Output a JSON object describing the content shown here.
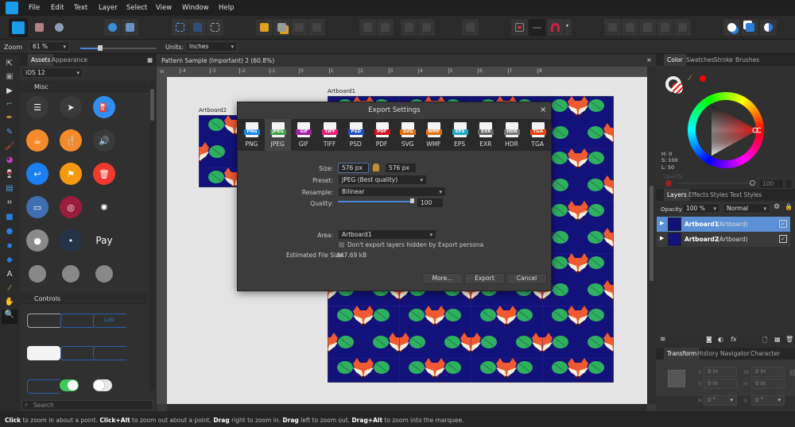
{
  "menu": [
    "File",
    "Edit",
    "Text",
    "Layer",
    "Select",
    "View",
    "Window",
    "Help"
  ],
  "context": {
    "zoom_label": "Zoom",
    "zoom_value": "61 %",
    "units_label": "Units:",
    "units_value": "Inches"
  },
  "assets": {
    "tabs": [
      "Assets",
      "Appearance"
    ],
    "category": "iOS 12",
    "misc_title": "Misc",
    "misc_icons": [
      {
        "icon": "list-icon",
        "color": "#3a3a3a",
        "glyph": "☰"
      },
      {
        "icon": "location-arrow-icon",
        "color": "#3a3a3a",
        "glyph": "➤"
      },
      {
        "icon": "fuel-icon",
        "color": "#2f8ef0",
        "glyph": "⛽"
      },
      {
        "icon": "coffee-icon",
        "color": "#f58a2a",
        "glyph": "☕"
      },
      {
        "icon": "cutlery-icon",
        "color": "#f58a2a",
        "glyph": "🍴"
      },
      {
        "icon": "speaker-icon",
        "color": "#3a3a3a",
        "glyph": "🔊"
      },
      {
        "icon": "reply-icon",
        "color": "#1a7ff0",
        "glyph": "↩"
      },
      {
        "icon": "flag-icon",
        "color": "#f59a10",
        "glyph": "⚑"
      },
      {
        "icon": "trash-icon",
        "color": "#f03a30",
        "glyph": "🗑"
      },
      {
        "icon": "archive-icon",
        "color": "#3f6fb0",
        "glyph": "▭"
      },
      {
        "icon": "fingerprint-icon",
        "color": "#9a1d3a",
        "glyph": "◎"
      },
      {
        "icon": "spinner-icon",
        "color": "#303030",
        "glyph": "✺"
      },
      {
        "icon": "avatar-icon",
        "color": "#8a8a8a",
        "glyph": "●"
      },
      {
        "icon": "radio-dot-icon",
        "color": "#26344a",
        "glyph": "•"
      },
      {
        "icon": "apple-pay-icon",
        "color": "#303030",
        "glyph": "Pay"
      },
      {
        "icon": "contact-icon",
        "color": "#888888",
        "glyph": ""
      },
      {
        "icon": "contact-icon",
        "color": "#888888",
        "glyph": ""
      },
      {
        "icon": "contact-badge-icon",
        "color": "#888888",
        "glyph": ""
      }
    ],
    "controls_title": "Controls",
    "controls_label": "Lab",
    "search_placeholder": "Search"
  },
  "document": {
    "title": "Pattern Sample (Important) 2 (60.8%)",
    "ruler_unit": "in",
    "ruler_ticks": [
      "-4",
      "-3",
      "-2",
      "-1",
      "0",
      "1",
      "2",
      "3",
      "4",
      "5",
      "6",
      "7",
      "8"
    ],
    "artboard1": "Artboard1",
    "artboard2": "Artboard2",
    "pattern_colors": {
      "background": "#13127a",
      "fox": "#ef5a32",
      "leaf": "#2fb060"
    }
  },
  "export_dialog": {
    "title": "Export Settings",
    "formats": [
      {
        "label": "PNG",
        "color": "#1e88e5"
      },
      {
        "label": "JPEG",
        "color": "#43a047"
      },
      {
        "label": "GIF",
        "color": "#a020a8"
      },
      {
        "label": "TIFF",
        "color": "#e8207a"
      },
      {
        "label": "PSD",
        "color": "#1f4fc8"
      },
      {
        "label": "PDF",
        "color": "#d01020"
      },
      {
        "label": "SVG",
        "color": "#e07010"
      },
      {
        "label": "WMF",
        "color": "#e07010"
      },
      {
        "label": "EPS",
        "color": "#20a8c0"
      },
      {
        "label": "EXR",
        "color": "#666666"
      },
      {
        "label": "HDR",
        "color": "#777777"
      },
      {
        "label": "TGA",
        "color": "#f04010"
      }
    ],
    "selected_format": "JPEG",
    "size_label": "Size:",
    "width": "576 px",
    "height": "576 px",
    "preset_label": "Preset:",
    "preset": "JPEG (Best quality)",
    "resample_label": "Resample:",
    "resample": "Bilinear",
    "quality_label": "Quality:",
    "quality": "100",
    "quality_percent": 100,
    "area_label": "Area:",
    "area": "Artboard1",
    "hidden_layers_label": "Don't export layers hidden by Export persona",
    "hidden_layers_checked": false,
    "file_size_label": "Estimated File Size:",
    "file_size": "447.69 kB",
    "more": "More...",
    "export": "Export",
    "cancel": "Cancel"
  },
  "color_panel": {
    "tabs": [
      "Color",
      "Swatches",
      "Stroke",
      "Brushes"
    ],
    "h": "H: 0",
    "s": "S: 100",
    "l": "L: 50",
    "opacity_label": "Opacity",
    "opacity": "100 %",
    "current_color": "#ff0000"
  },
  "layers_panel": {
    "tabs": [
      "Layers",
      "Effects",
      "Styles",
      "Text Styles"
    ],
    "opacity_label": "Opacity:",
    "opacity": "100 %",
    "blend": "Normal",
    "layers": [
      {
        "name": "Artboard1",
        "type": "(Artboard)",
        "selected": true,
        "visible": true
      },
      {
        "name": "Artboard2",
        "type": "(Artboard)",
        "selected": false,
        "visible": true
      }
    ]
  },
  "transform_panel": {
    "tabs": [
      "Transform",
      "History",
      "Navigator",
      "Character"
    ],
    "x_label": "X:",
    "x": "0 in",
    "y_label": "Y:",
    "y": "0 in",
    "w_label": "W:",
    "w": "0 in",
    "h_label": "H:",
    "h": "0 in",
    "r_label": "R:",
    "r": "0 °",
    "s_label": "S:",
    "s": "0 °"
  },
  "status": {
    "parts": [
      [
        "Click",
        " to zoom in about a point. "
      ],
      [
        "Click+Alt",
        " to zoom out about a point. "
      ],
      [
        "Drag",
        " right to zoom in. "
      ],
      [
        "Drag",
        " left to zoom out. "
      ],
      [
        "Drag+Alt",
        " to zoom into the marquee."
      ]
    ]
  }
}
